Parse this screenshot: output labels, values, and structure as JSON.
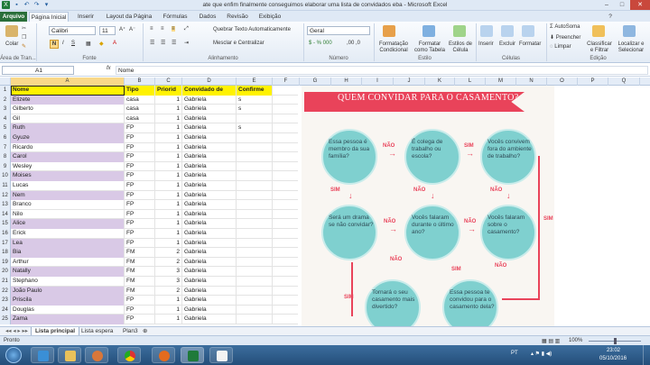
{
  "title": "ate que enfim finalmente conseguimos elaborar uma lista de convidados eba  -  Microsoft Excel",
  "quick_access": [
    "excel-icon",
    "save-icon",
    "undo-icon",
    "redo-icon"
  ],
  "tabs": [
    "Arquivo",
    "Página Inicial",
    "Inserir",
    "Layout da Página",
    "Fórmulas",
    "Dados",
    "Revisão",
    "Exibição"
  ],
  "ribbon": {
    "paste": "Colar",
    "font_name": "Calibri",
    "font_size": "11",
    "wrap_text": "Quebrar Texto Automaticamente",
    "merge": "Mesclar e Centralizar",
    "number_format": "Geral",
    "cond_format": "Formatação Condicional",
    "format_table": "Formatar como Tabela",
    "cell_styles": "Estilos de Célula",
    "insert": "Inserir",
    "delete": "Excluir",
    "format": "Formatar",
    "autosum": "AutoSoma",
    "fill": "Preencher",
    "clear": "Limpar",
    "sort_filter": "Classificar e Filtrar",
    "find_select": "Localizar e Selecionar",
    "groups": [
      "Área de Tran...",
      "Fonte",
      "Alinhamento",
      "Número",
      "Estilo",
      "Células",
      "Edição"
    ]
  },
  "formula_bar": {
    "cell_ref": "A1",
    "fx": "fx",
    "content": "Nome"
  },
  "columns": [
    "A",
    "B",
    "C",
    "D",
    "E",
    "F",
    "G",
    "H",
    "I",
    "J",
    "K",
    "L",
    "M",
    "N",
    "O",
    "P",
    "Q"
  ],
  "headers": [
    "Nome",
    "Tipo",
    "Priorid",
    "Convidado de",
    "Confirme"
  ],
  "rows": [
    {
      "n": "2",
      "name": "Elizete",
      "tipo": "casa",
      "prio": "1",
      "conv": "Gabriela",
      "conf": "s"
    },
    {
      "n": "3",
      "name": "Gilberto",
      "tipo": "casa",
      "prio": "1",
      "conv": "Gabriela",
      "conf": "s"
    },
    {
      "n": "4",
      "name": "Gil",
      "tipo": "casa",
      "prio": "1",
      "conv": "Gabriela",
      "conf": ""
    },
    {
      "n": "5",
      "name": "Ruth",
      "tipo": "FP",
      "prio": "1",
      "conv": "Gabriela",
      "conf": "s"
    },
    {
      "n": "6",
      "name": "Gyuze",
      "tipo": "FP",
      "prio": "1",
      "conv": "Gabriela",
      "conf": ""
    },
    {
      "n": "7",
      "name": "Ricardo",
      "tipo": "FP",
      "prio": "1",
      "conv": "Gabriela",
      "conf": ""
    },
    {
      "n": "8",
      "name": "Carol",
      "tipo": "FP",
      "prio": "1",
      "conv": "Gabriela",
      "conf": ""
    },
    {
      "n": "9",
      "name": "Wesley",
      "tipo": "FP",
      "prio": "1",
      "conv": "Gabriela",
      "conf": ""
    },
    {
      "n": "10",
      "name": "Moises",
      "tipo": "FP",
      "prio": "1",
      "conv": "Gabriela",
      "conf": ""
    },
    {
      "n": "11",
      "name": "Lucas",
      "tipo": "FP",
      "prio": "1",
      "conv": "Gabriela",
      "conf": ""
    },
    {
      "n": "12",
      "name": "Nem",
      "tipo": "FP",
      "prio": "1",
      "conv": "Gabriela",
      "conf": ""
    },
    {
      "n": "13",
      "name": "Branco",
      "tipo": "FP",
      "prio": "1",
      "conv": "Gabriela",
      "conf": ""
    },
    {
      "n": "14",
      "name": "Nilo",
      "tipo": "FP",
      "prio": "1",
      "conv": "Gabriela",
      "conf": ""
    },
    {
      "n": "15",
      "name": "Alice",
      "tipo": "FP",
      "prio": "1",
      "conv": "Gabriela",
      "conf": ""
    },
    {
      "n": "16",
      "name": "Erick",
      "tipo": "FP",
      "prio": "1",
      "conv": "Gabriela",
      "conf": ""
    },
    {
      "n": "17",
      "name": "Lea",
      "tipo": "FP",
      "prio": "1",
      "conv": "Gabriela",
      "conf": ""
    },
    {
      "n": "18",
      "name": "Bia",
      "tipo": "FM",
      "prio": "2",
      "conv": "Gabriela",
      "conf": ""
    },
    {
      "n": "19",
      "name": "Arthur",
      "tipo": "FM",
      "prio": "2",
      "conv": "Gabriela",
      "conf": ""
    },
    {
      "n": "20",
      "name": "Natally",
      "tipo": "FM",
      "prio": "3",
      "conv": "Gabriela",
      "conf": ""
    },
    {
      "n": "21",
      "name": "Stephano",
      "tipo": "FM",
      "prio": "3",
      "conv": "Gabriela",
      "conf": ""
    },
    {
      "n": "22",
      "name": "João Paulo",
      "tipo": "FM",
      "prio": "2",
      "conv": "Gabriela",
      "conf": ""
    },
    {
      "n": "23",
      "name": "Priscila",
      "tipo": "FP",
      "prio": "1",
      "conv": "Gabriela",
      "conf": ""
    },
    {
      "n": "24",
      "name": "Douglas",
      "tipo": "FP",
      "prio": "1",
      "conv": "Gabriela",
      "conf": ""
    },
    {
      "n": "25",
      "name": "Zama",
      "tipo": "FP",
      "prio": "1",
      "conv": "Gabriela",
      "conf": ""
    }
  ],
  "infographic": {
    "title": "QUEM CONVIDAR PARA O CASAMENTO?",
    "q1": "Essa pessoa é membro da sua família?",
    "q2": "É colega de trabalho ou escola?",
    "q3": "Vocês convivem fora do ambiente de trabalho?",
    "q4": "Será um drama se não convidar?",
    "q5": "Vocês falaram durante o último ano?",
    "q6": "Vocês falaram sobre o casamento?",
    "q7": "Tornará o seu casamento mais divertido?",
    "q8": "Essa pessoa te convidou para o casamento dela?",
    "nao": "NÃO",
    "sim": "SIM"
  },
  "sheet_tabs": [
    "Lista principal",
    "Lista espera",
    "Plan3"
  ],
  "status": {
    "left": "Pronto",
    "zoom": "100%"
  },
  "taskbar": {
    "lang": "PT",
    "time": "23:02",
    "date": "05/10/2016"
  },
  "colors": {
    "accent": "#e9435a",
    "circle": "#7fd0cf",
    "header_fill": "#fff200",
    "lavender": "#d9c9e6",
    "file_tab": "#2a6f3a"
  }
}
